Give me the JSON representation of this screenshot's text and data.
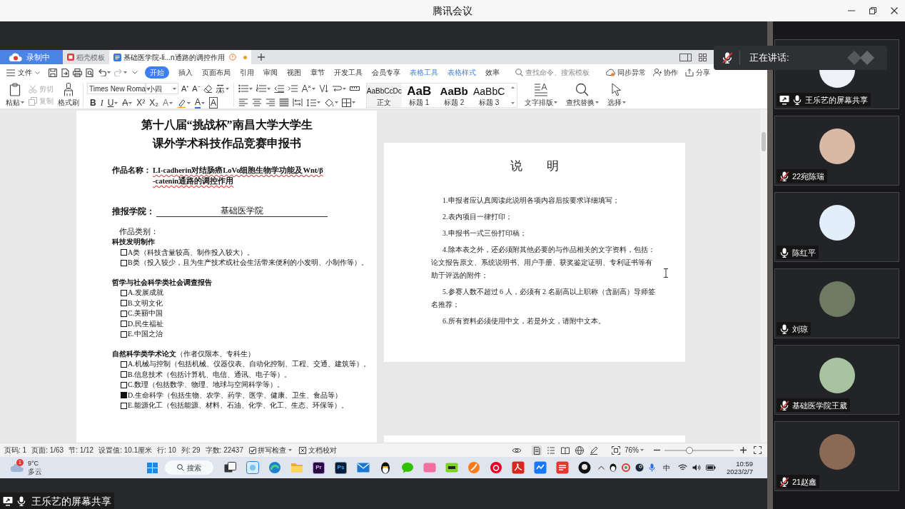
{
  "window": {
    "title": "腾讯会议"
  },
  "shared_screen": {
    "recording_badge": "录制中",
    "tabs": [
      {
        "label": "稻壳模板",
        "kind": "template",
        "selected": false
      },
      {
        "label": "基础医学院-li...n通路的调控作用",
        "kind": "document",
        "selected": true
      }
    ],
    "menu": {
      "file": "文件",
      "tabs": [
        {
          "label": "开始",
          "kind": "main",
          "selected": true
        },
        {
          "label": "插入",
          "kind": "main",
          "selected": false
        },
        {
          "label": "页面布局",
          "kind": "main",
          "selected": false
        },
        {
          "label": "引用",
          "kind": "main",
          "selected": false
        },
        {
          "label": "审阅",
          "kind": "main",
          "selected": false
        },
        {
          "label": "视图",
          "kind": "main",
          "selected": false
        },
        {
          "label": "章节",
          "kind": "main",
          "selected": false
        },
        {
          "label": "开发工具",
          "kind": "main",
          "selected": false
        },
        {
          "label": "会员专享",
          "kind": "main",
          "selected": false
        },
        {
          "label": "表格工具",
          "kind": "context",
          "selected": false
        },
        {
          "label": "表格样式",
          "kind": "context",
          "selected": false
        },
        {
          "label": "效率",
          "kind": "main",
          "selected": false
        }
      ],
      "search": {
        "placeholder": "查找命令、搜索模板"
      },
      "actions": [
        {
          "label": "同步异常"
        },
        {
          "label": "协作"
        },
        {
          "label": "分享"
        }
      ]
    },
    "ribbon": {
      "clipboard": [
        {
          "label": "粘贴",
          "disabled": false
        },
        {
          "label": "剪切",
          "disabled": true
        },
        {
          "label": "复制",
          "disabled": true
        },
        {
          "label": "格式刷",
          "disabled": false
        }
      ],
      "font": {
        "family": "Times New Roma",
        "size": "小四"
      },
      "size_buttons": [
        "A⁺",
        "A⁻"
      ],
      "format_buttons": [
        {
          "glyph": "B",
          "kind": "bold"
        },
        {
          "glyph": "I",
          "kind": "italic"
        },
        {
          "glyph": "U",
          "kind": "underline"
        },
        {
          "glyph": "A",
          "kind": "strike"
        },
        {
          "glyph": "X²",
          "kind": "plain"
        },
        {
          "glyph": "X₂",
          "kind": "plain"
        },
        {
          "glyph": "A",
          "kind": "outline"
        },
        {
          "kind": "highlight"
        },
        {
          "glyph": "A",
          "kind": "color"
        },
        {
          "glyph": "A",
          "kind": "boxed"
        }
      ],
      "alignment": [
        {
          "selected": false
        },
        {
          "selected": false
        },
        {
          "selected": false
        },
        {
          "selected": true
        },
        {
          "selected": false
        }
      ],
      "styles": [
        {
          "preview": "AaBbCcDc",
          "label": "正文"
        },
        {
          "preview": "AaB",
          "label": "标题 1"
        },
        {
          "preview": "AaBb",
          "label": "标题 2"
        },
        {
          "preview": "AaBbC",
          "label": "标题 3"
        }
      ],
      "tools": [
        {
          "label": "文字排版"
        },
        {
          "label": "查找替换"
        },
        {
          "label": "选择"
        }
      ]
    },
    "document": {
      "cover_page": {
        "title_lines": [
          "第十八届“挑战杯”南昌大学大学生",
          "课外学术科技作品竞赛申报书"
        ],
        "work_name": {
          "label": "作品名称：",
          "lines": [
            "LI-cadherin对结肠癌LoVo细胞生物学功能及Wnt/β",
            "-catenin通路的调控作用"
          ]
        },
        "college": {
          "label": "推报学院：",
          "value": "基础医学院"
        },
        "category_label": "作品类别：",
        "categories": [
          {
            "heading": "科技发明制作",
            "options": [
              {
                "text": "A类（科技含量较高、制作投入较大）。",
                "checked": false
              },
              {
                "text": "B类（投入较少，且为生产技术或社会生活带来便利的小发明、小制作等）。",
                "checked": false
              }
            ]
          },
          {
            "heading": "哲学与社会科学类社会调查报告",
            "options": [
              {
                "text": "A.发展成就",
                "checked": false
              },
              {
                "text": "B.文明文化",
                "checked": false
              },
              {
                "text": "C.美丽中国",
                "checked": false
              },
              {
                "text": "D.民生福祉",
                "checked": false
              },
              {
                "text": "E.中国之治",
                "checked": false
              }
            ]
          },
          {
            "heading": "自然科学类学术论文",
            "note": "（作者仅限本、专科生）",
            "options": [
              {
                "text": "A.机械与控制（包括机械、仪器仪表、自动化控制、工程、交通、建筑等）。",
                "checked": false
              },
              {
                "text": "B.信息技术（包括计算机、电信、通讯、电子等）。",
                "checked": false
              },
              {
                "text": "C.数理（包括数学、物理、地球与空间科学等）。",
                "checked": false
              },
              {
                "text": "D.生命科学（包括生物、农学、药学、医学、健康、卫生、食品等）",
                "checked": true
              },
              {
                "text": "E.能源化工（包括能源、材料、石油、化学、化工、生态、环保等）。",
                "checked": false
              }
            ]
          }
        ]
      },
      "notes_page": {
        "title": "说　　明",
        "items": [
          "1.申报者应认真阅读此说明各项内容后按要求详细填写；",
          "2.表内项目一律打印；",
          "3.申报书一式三份打印稿；",
          "4.除本表之外，还必须附其他必要的与作品相关的文字资料，包括：论文报告原文、系统说明书、用户手册、获奖鉴定证明、专利证书等有助于评选的附件；",
          "5.参赛人数不超过 6 人，必须有 2 名副高以上职称（含副高）导师签名推荐；",
          "6.所有资料必须使用中文，若是外文，请附中文本。"
        ]
      }
    },
    "status_bar": {
      "fields": [
        "页码: 1",
        "页面: 1/63",
        "节: 1/12",
        "设置值: 10.1厘米",
        "行: 10",
        "列: 29",
        "字数: 22437"
      ],
      "spell_check": {
        "label": "拼写检查",
        "checked": true
      },
      "proofread": "文档校对",
      "views": [
        {
          "selected": true
        },
        {
          "selected": false
        },
        {
          "selected": false
        },
        {
          "selected": false
        },
        {
          "selected": false
        }
      ],
      "zoom": {
        "value": "76%",
        "level": 0.36
      }
    },
    "taskbar": {
      "weather": {
        "badge": "1",
        "temperature": "9°C",
        "condition": "多云"
      },
      "search": "搜索",
      "app_labels": [
        "Pr",
        "Ps"
      ],
      "ime": "中",
      "time": "10:59",
      "date": "2023/2/7"
    }
  },
  "speaking_indicator": {
    "label": "正在讲话:",
    "muted": true
  },
  "participants": [
    {
      "name": "王乐艺的屏幕共享",
      "muted": false,
      "sharing": true
    },
    {
      "name": "22宛陈瑞",
      "muted": true,
      "sharing": false
    },
    {
      "name": "陈红平",
      "muted": false,
      "sharing": false
    },
    {
      "name": "刘琼",
      "muted": false,
      "sharing": false
    },
    {
      "name": "基础医学院王葳",
      "muted": true,
      "sharing": false
    },
    {
      "name": "21赵鑫",
      "muted": true,
      "sharing": false
    }
  ],
  "share_label": {
    "name": "王乐艺的屏幕共享",
    "muted": false
  }
}
